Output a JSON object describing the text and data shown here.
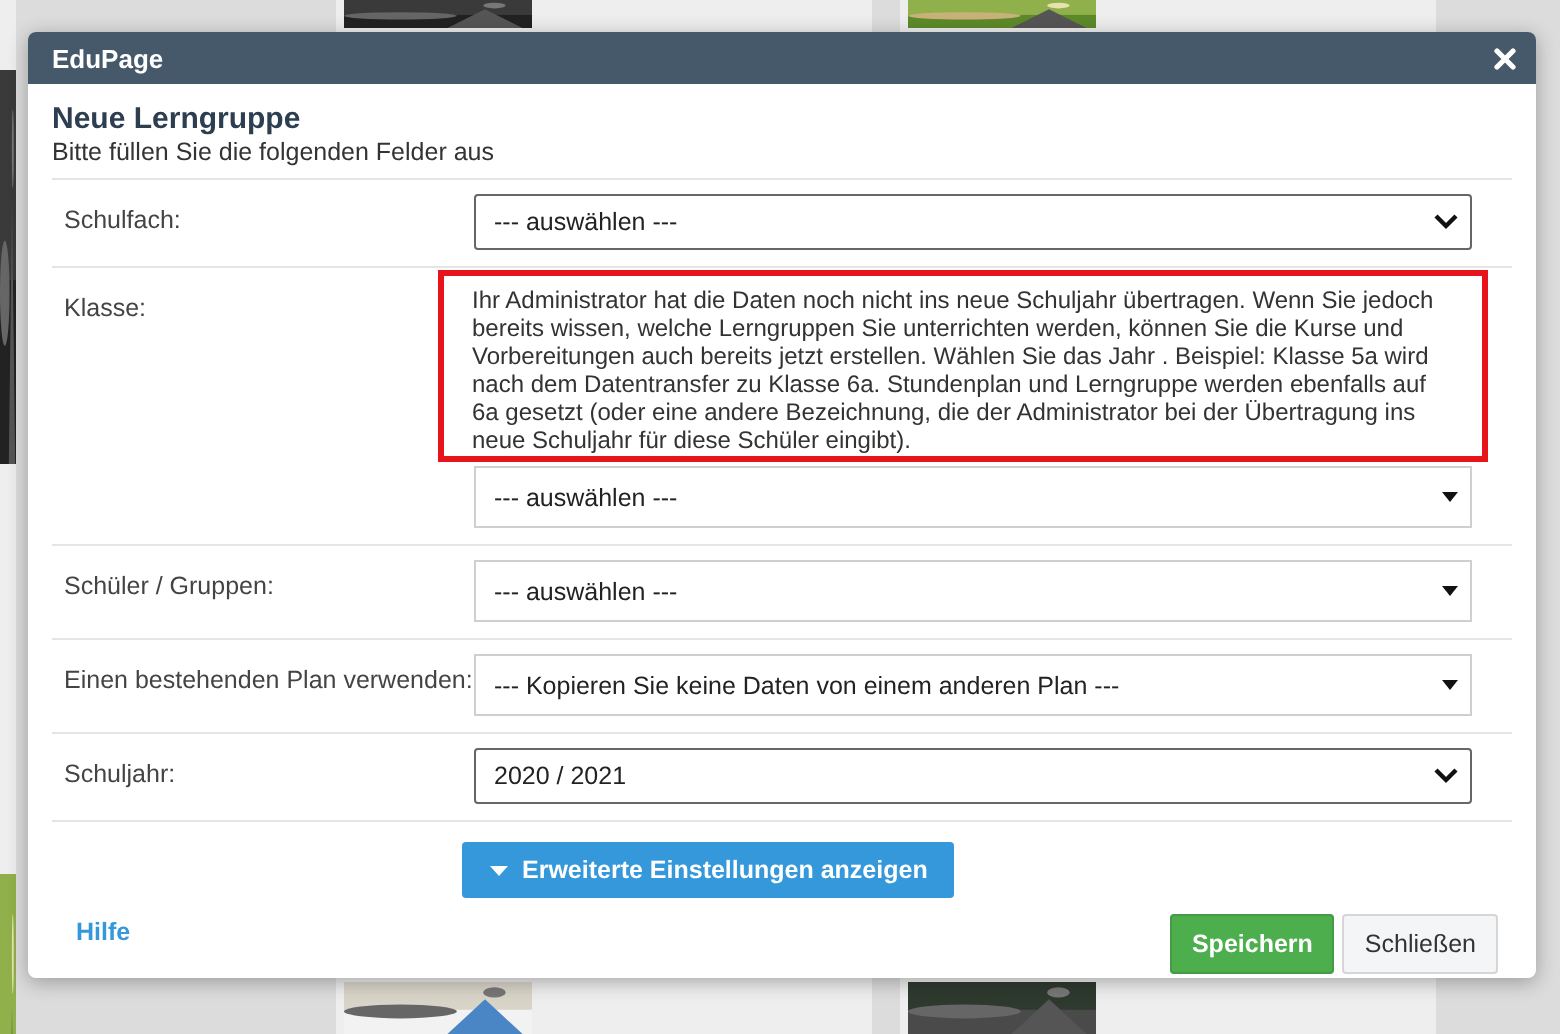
{
  "window": {
    "title": "EduPage"
  },
  "form": {
    "title": "Neue Lerngruppe",
    "subtitle": "Bitte füllen Sie die folgenden Felder aus"
  },
  "fields": [
    {
      "label": "Schulfach:",
      "kind": "native",
      "value": "--- auswählen ---"
    },
    {
      "label": "Klasse:",
      "kind": "custom",
      "value": "--- auswählen ---",
      "notice": "Ihr Administrator hat die Daten noch nicht ins neue Schuljahr übertragen. Wenn Sie jedoch bereits wissen, welche Lerngruppen Sie unterrichten werden, können Sie die Kurse und Vorbereitungen auch bereits jetzt erstellen. Wählen Sie das Jahr . Beispiel: Klasse 5a wird nach dem Datentransfer zu Klasse 6a. Stundenplan und Lerngruppe werden ebenfalls auf 6a gesetzt (oder eine andere Bezeichnung, die der Administrator bei der Übertragung ins neue Schuljahr für diese Schüler eingibt)."
    },
    {
      "label": "Schüler / Gruppen:",
      "kind": "custom",
      "value": "--- auswählen ---"
    },
    {
      "label": "Einen bestehenden Plan verwenden:",
      "kind": "custom",
      "value": "--- Kopieren Sie keine Daten von einem anderen Plan ---"
    },
    {
      "label": "Schuljahr:",
      "kind": "native",
      "value": "2020 / 2021"
    }
  ],
  "advanced_button": "Erweiterte Einstellungen anzeigen",
  "help_link": "Hilfe",
  "buttons": [
    {
      "label": "Speichern",
      "kind": "primary"
    },
    {
      "label": "Schließen",
      "kind": "secondary"
    }
  ]
}
